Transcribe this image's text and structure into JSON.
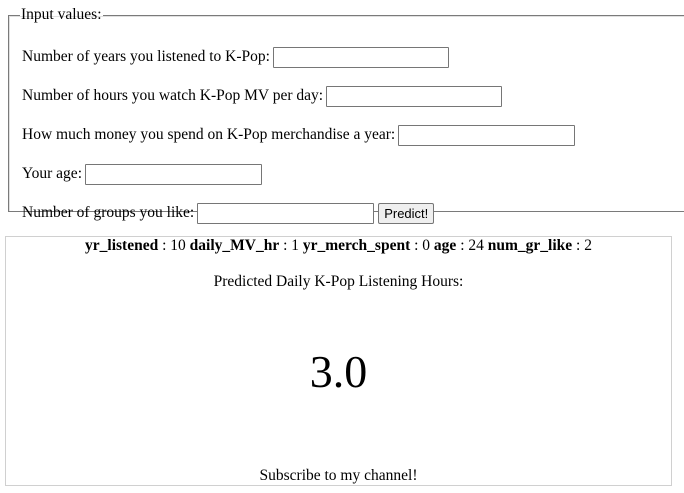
{
  "form": {
    "legend": "Input values:",
    "fields": [
      {
        "label": "Number of years you listened to K-Pop:",
        "value": "",
        "placeholder": ""
      },
      {
        "label": "Number of hours you watch K-Pop MV per day:",
        "value": "",
        "placeholder": ""
      },
      {
        "label": "How much money you spend on K-Pop merchandise a year:",
        "value": "",
        "placeholder": ""
      },
      {
        "label": "Your age:",
        "value": "",
        "placeholder": ""
      },
      {
        "label": "Number of groups you like:",
        "value": "",
        "placeholder": ""
      }
    ],
    "submit_label": "Predict!"
  },
  "result": {
    "params": [
      {
        "key": "yr_listened",
        "value": "10"
      },
      {
        "key": "daily_MV_hr",
        "value": "1"
      },
      {
        "key": "yr_merch_spent",
        "value": "0"
      },
      {
        "key": "age",
        "value": "24"
      },
      {
        "key": "num_gr_like",
        "value": "2"
      }
    ],
    "separator": ":",
    "prediction_label": "Predicted Daily K-Pop Listening Hours:",
    "prediction_value": "3.0",
    "subscribe_text": "Subscribe to my channel!"
  }
}
